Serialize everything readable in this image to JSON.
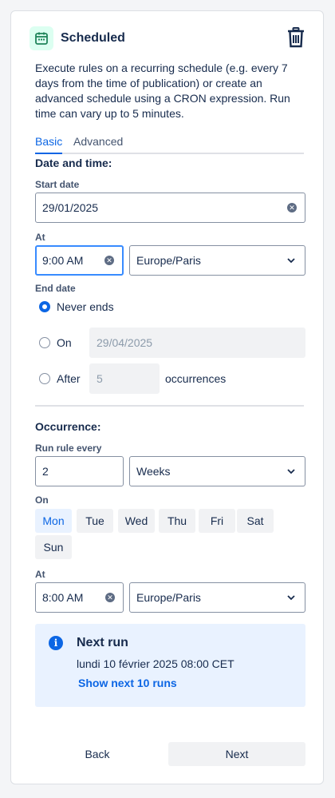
{
  "header": {
    "title": "Scheduled",
    "icon": "calendar-icon",
    "delete_icon": "trash-icon",
    "accent": "#1f845a"
  },
  "description": "Execute rules on a recurring schedule (e.g. every 7 days from the time of publication) or create an advanced schedule using a CRON expression. Run time can vary up to 5 minutes.",
  "tabs": [
    {
      "label": "Basic",
      "active": true
    },
    {
      "label": "Advanced",
      "active": false
    }
  ],
  "date_time": {
    "section_title": "Date and time:",
    "start_date": {
      "label": "Start date",
      "value": "29/01/2025"
    },
    "at": {
      "label": "At",
      "time_value": "9:00 AM",
      "timezone": "Europe/Paris"
    },
    "end_date": {
      "label": "End date",
      "options": [
        {
          "label": "Never ends",
          "selected": true
        },
        {
          "label": "On",
          "selected": false,
          "value": "29/04/2025"
        },
        {
          "label": "After",
          "selected": false,
          "value": "5",
          "suffix": "occurrences"
        }
      ]
    }
  },
  "occurrence": {
    "section_title": "Occurrence:",
    "run_every": {
      "label": "Run rule every",
      "value": "2",
      "unit": "Weeks"
    },
    "on": {
      "label": "On",
      "days": [
        {
          "label": "Mon",
          "selected": true
        },
        {
          "label": "Tue",
          "selected": false
        },
        {
          "label": "Wed",
          "selected": false
        },
        {
          "label": "Thu",
          "selected": false
        },
        {
          "label": "Fri",
          "selected": false
        },
        {
          "label": "Sat",
          "selected": false
        },
        {
          "label": "Sun",
          "selected": false
        }
      ]
    },
    "at": {
      "label": "At",
      "time_value": "8:00 AM",
      "timezone": "Europe/Paris"
    }
  },
  "next_run": {
    "icon": "info-icon",
    "title": "Next run",
    "text": "lundi 10 février 2025 08:00 CET",
    "link": "Show next 10 runs"
  },
  "footer": {
    "back_label": "Back",
    "next_label": "Next"
  },
  "colors": {
    "primary": "#0c66e4",
    "icon_bg": "#dcfff1",
    "info_bg": "#e9f2ff"
  }
}
